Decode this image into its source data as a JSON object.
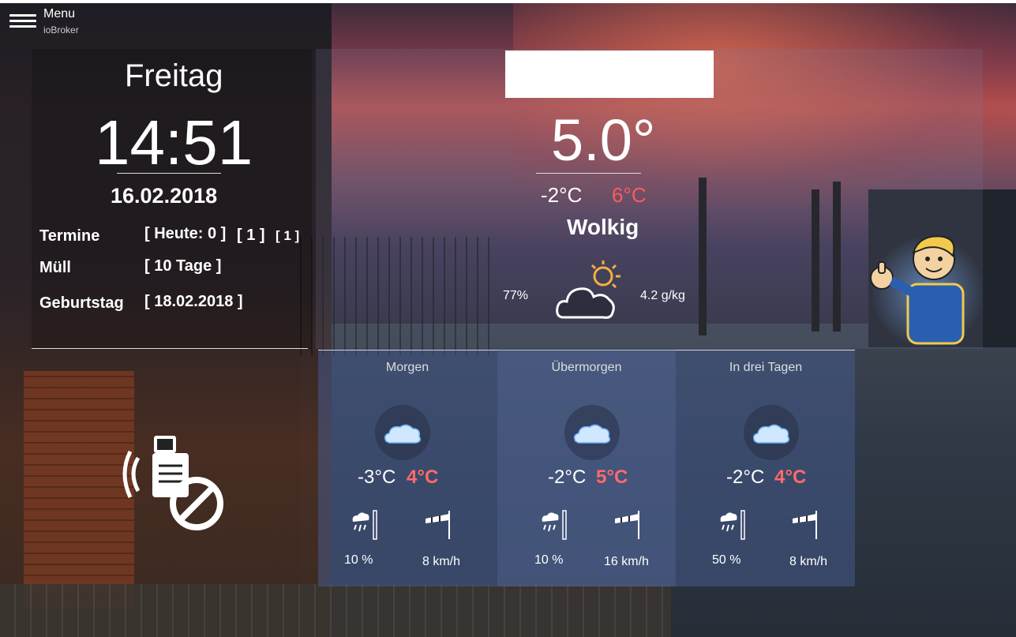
{
  "menu": {
    "label": "Menu",
    "sub": "ioBroker"
  },
  "clock": {
    "day": "Freitag",
    "time": "14:51",
    "date": "16.02.2018"
  },
  "info_rows": [
    {
      "label": "Termine",
      "value": "[ Heute: 0 ]",
      "extra1": "[ 1 ]",
      "extra2": "[ 1 ]"
    },
    {
      "label": "Müll",
      "value": "[ 10 Tage ]"
    },
    {
      "label": "Geburtstag",
      "value": "[ 18.02.2018 ]"
    }
  ],
  "current": {
    "temp": "5.0°",
    "min": "-2°C",
    "max": "6°C",
    "condition": "Wolkig",
    "humidity": "77%",
    "abs_humidity": "4.2 g/kg"
  },
  "forecast": [
    {
      "label": "Morgen",
      "min": "-3°C",
      "max": "4°C",
      "rain": "10 %",
      "wind": "8 km/h"
    },
    {
      "label": "Übermorgen",
      "min": "-2°C",
      "max": "5°C",
      "rain": "10 %",
      "wind": "16 km/h"
    },
    {
      "label": "In drei Tagen",
      "min": "-2°C",
      "max": "4°C",
      "rain": "50 %",
      "wind": "8 km/h"
    }
  ],
  "colors": {
    "max_temp": "#ff5a5a",
    "cloud": "#cfe8ff"
  },
  "icons": [
    "menu-icon",
    "cloud-sun-icon",
    "cloud-icon",
    "rain-gauge-icon",
    "windsock-icon",
    "phone-off-icon",
    "mascot-thumbs-up"
  ]
}
